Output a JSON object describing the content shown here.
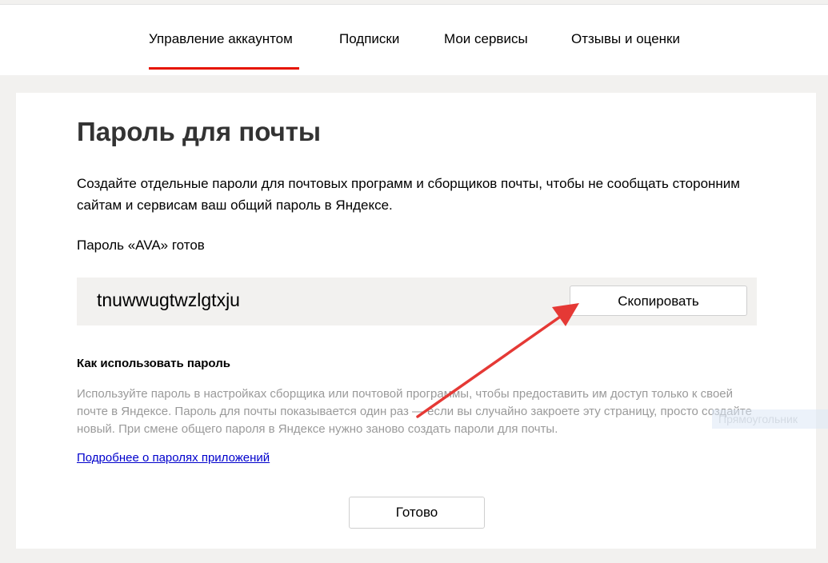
{
  "tabs": [
    {
      "label": "Управление аккаунтом",
      "active": true
    },
    {
      "label": "Подписки"
    },
    {
      "label": "Мои сервисы"
    },
    {
      "label": "Отзывы и оценки"
    }
  ],
  "page": {
    "title": "Пароль для почты",
    "description": "Создайте отдельные пароли для почтовых программ и сборщиков почты, чтобы не сообщать сторонним сайтам и сервисам ваш общий пароль в Яндексе.",
    "ready_text": "Пароль «AVA» готов",
    "password": "tnuwwugtwzlgtxju",
    "copy_button": "Скопировать",
    "how_title": "Как использовать пароль",
    "how_text": "Используйте пароль в настройках сборщика или почтовой программы, чтобы предоставить им доступ только к своей почте в Яндексе. Пароль для почты показывается один раз — если вы случайно закроете эту страницу, просто создайте новый. При смене общего пароля в Яндексе нужно заново создать пароли для почты.",
    "more_link": "Подробнее о паролях приложений",
    "done_button": "Готово"
  },
  "overlay": {
    "ghost_label": "Прямоугольник",
    "arrow_color": "#e53935"
  },
  "colors": {
    "accent": "#e61400",
    "link": "#0000cc",
    "muted_text": "#9a9a9a"
  }
}
